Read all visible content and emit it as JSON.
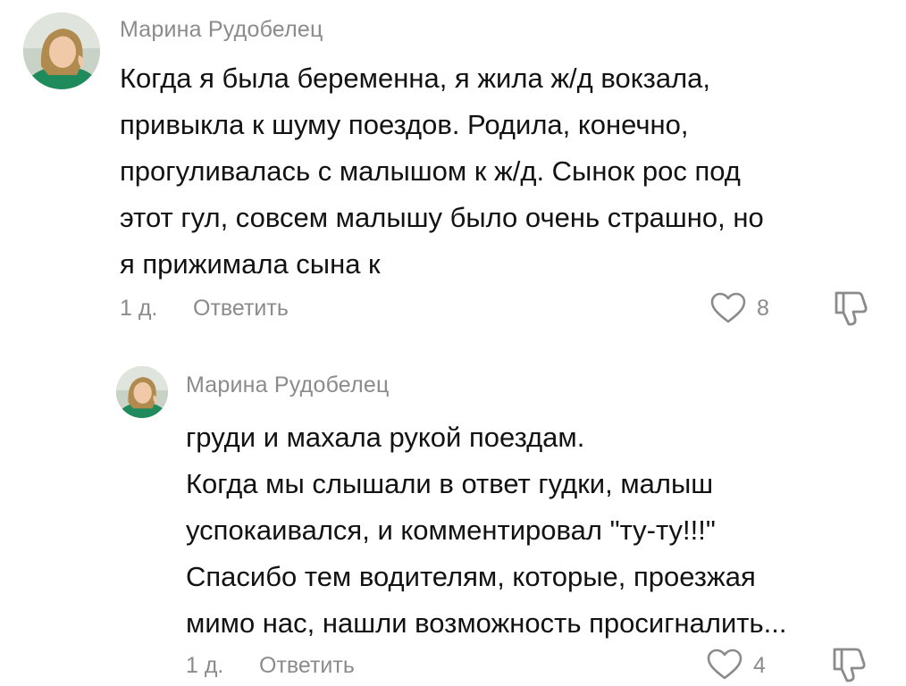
{
  "comments": [
    {
      "author": "Марина Рудобелец",
      "lines": [
        "Когда я была беременна, я жила ж/д вокзала,",
        "привыкла к шуму поездов. Родила, конечно,",
        "прогуливалась с малышом к ж/д. Сынок рос под",
        "этот гул, совсем малышу было очень страшно, но",
        "я прижимала сына к"
      ],
      "time": "1 д.",
      "reply_label": "Ответить",
      "likes": "8"
    },
    {
      "author": "Марина Рудобелец",
      "lines": [
        "груди и махала рукой поездам.",
        "Когда мы слышали в ответ гудки, малыш",
        "успокаивался, и комментировал \"ту-ту!!!\"",
        "Спасибо тем водителям, которые, проезжая",
        "мимо нас, нашли возможность просигналить..."
      ],
      "time": "1 д.",
      "reply_label": "Ответить",
      "likes": "4"
    }
  ],
  "icons": {
    "like": "heart-icon",
    "dislike": "thumbs-down-icon",
    "avatar": "user-avatar"
  },
  "colors": {
    "text": "#121212",
    "muted": "#8b8b8b",
    "background": "#ffffff"
  }
}
